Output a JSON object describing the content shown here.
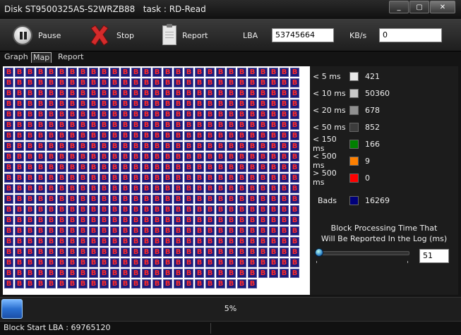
{
  "window": {
    "title": "Disk ST9500325AS-S2WRZB88   task : RD-Read"
  },
  "window_buttons": [
    "_",
    "▢",
    "✕"
  ],
  "toolbar": {
    "pause_label": "Pause",
    "stop_label": "Stop",
    "report_label": "Report",
    "lba_label": "LBA",
    "lba_value": "53745664",
    "kbs_label": "KB/s",
    "kbs_value": "0"
  },
  "tabs": [
    {
      "label": "Graph",
      "active": false
    },
    {
      "label": "Map",
      "active": true
    },
    {
      "label": "Report",
      "active": false
    }
  ],
  "block_map": {
    "cell_text": "B",
    "cell_color": "#1a1a7a",
    "cell_text_color": "#ff2a2a",
    "full_rows": 20,
    "cols": 29,
    "last_row_cells": 4
  },
  "legend": {
    "items": [
      {
        "label": "< 5 ms",
        "color": "#e8e8e8",
        "value": "421"
      },
      {
        "label": "< 10 ms",
        "color": "#c8c8c8",
        "value": "50360"
      },
      {
        "label": "< 20 ms",
        "color": "#909090",
        "value": "678"
      },
      {
        "label": "< 50 ms",
        "color": "#3c3c3c",
        "value": "852"
      },
      {
        "label": "< 150 ms",
        "color": "#008000",
        "value": "166"
      },
      {
        "label": "< 500 ms",
        "color": "#ff8000",
        "value": "9"
      },
      {
        "label": "> 500 ms",
        "color": "#ff0000",
        "value": "0"
      }
    ],
    "bads": {
      "label": "Bads",
      "color": "#00007a",
      "value": "16269"
    }
  },
  "threshold": {
    "note_line1": "Block Processing Time That",
    "note_line2": "Will Be Reported In the Log (ms)",
    "value": "51",
    "slider_level": 0.0
  },
  "progress": {
    "percent_text": "5%",
    "fraction": 0.05
  },
  "status": {
    "text": "Block Start LBA : 69765120"
  }
}
